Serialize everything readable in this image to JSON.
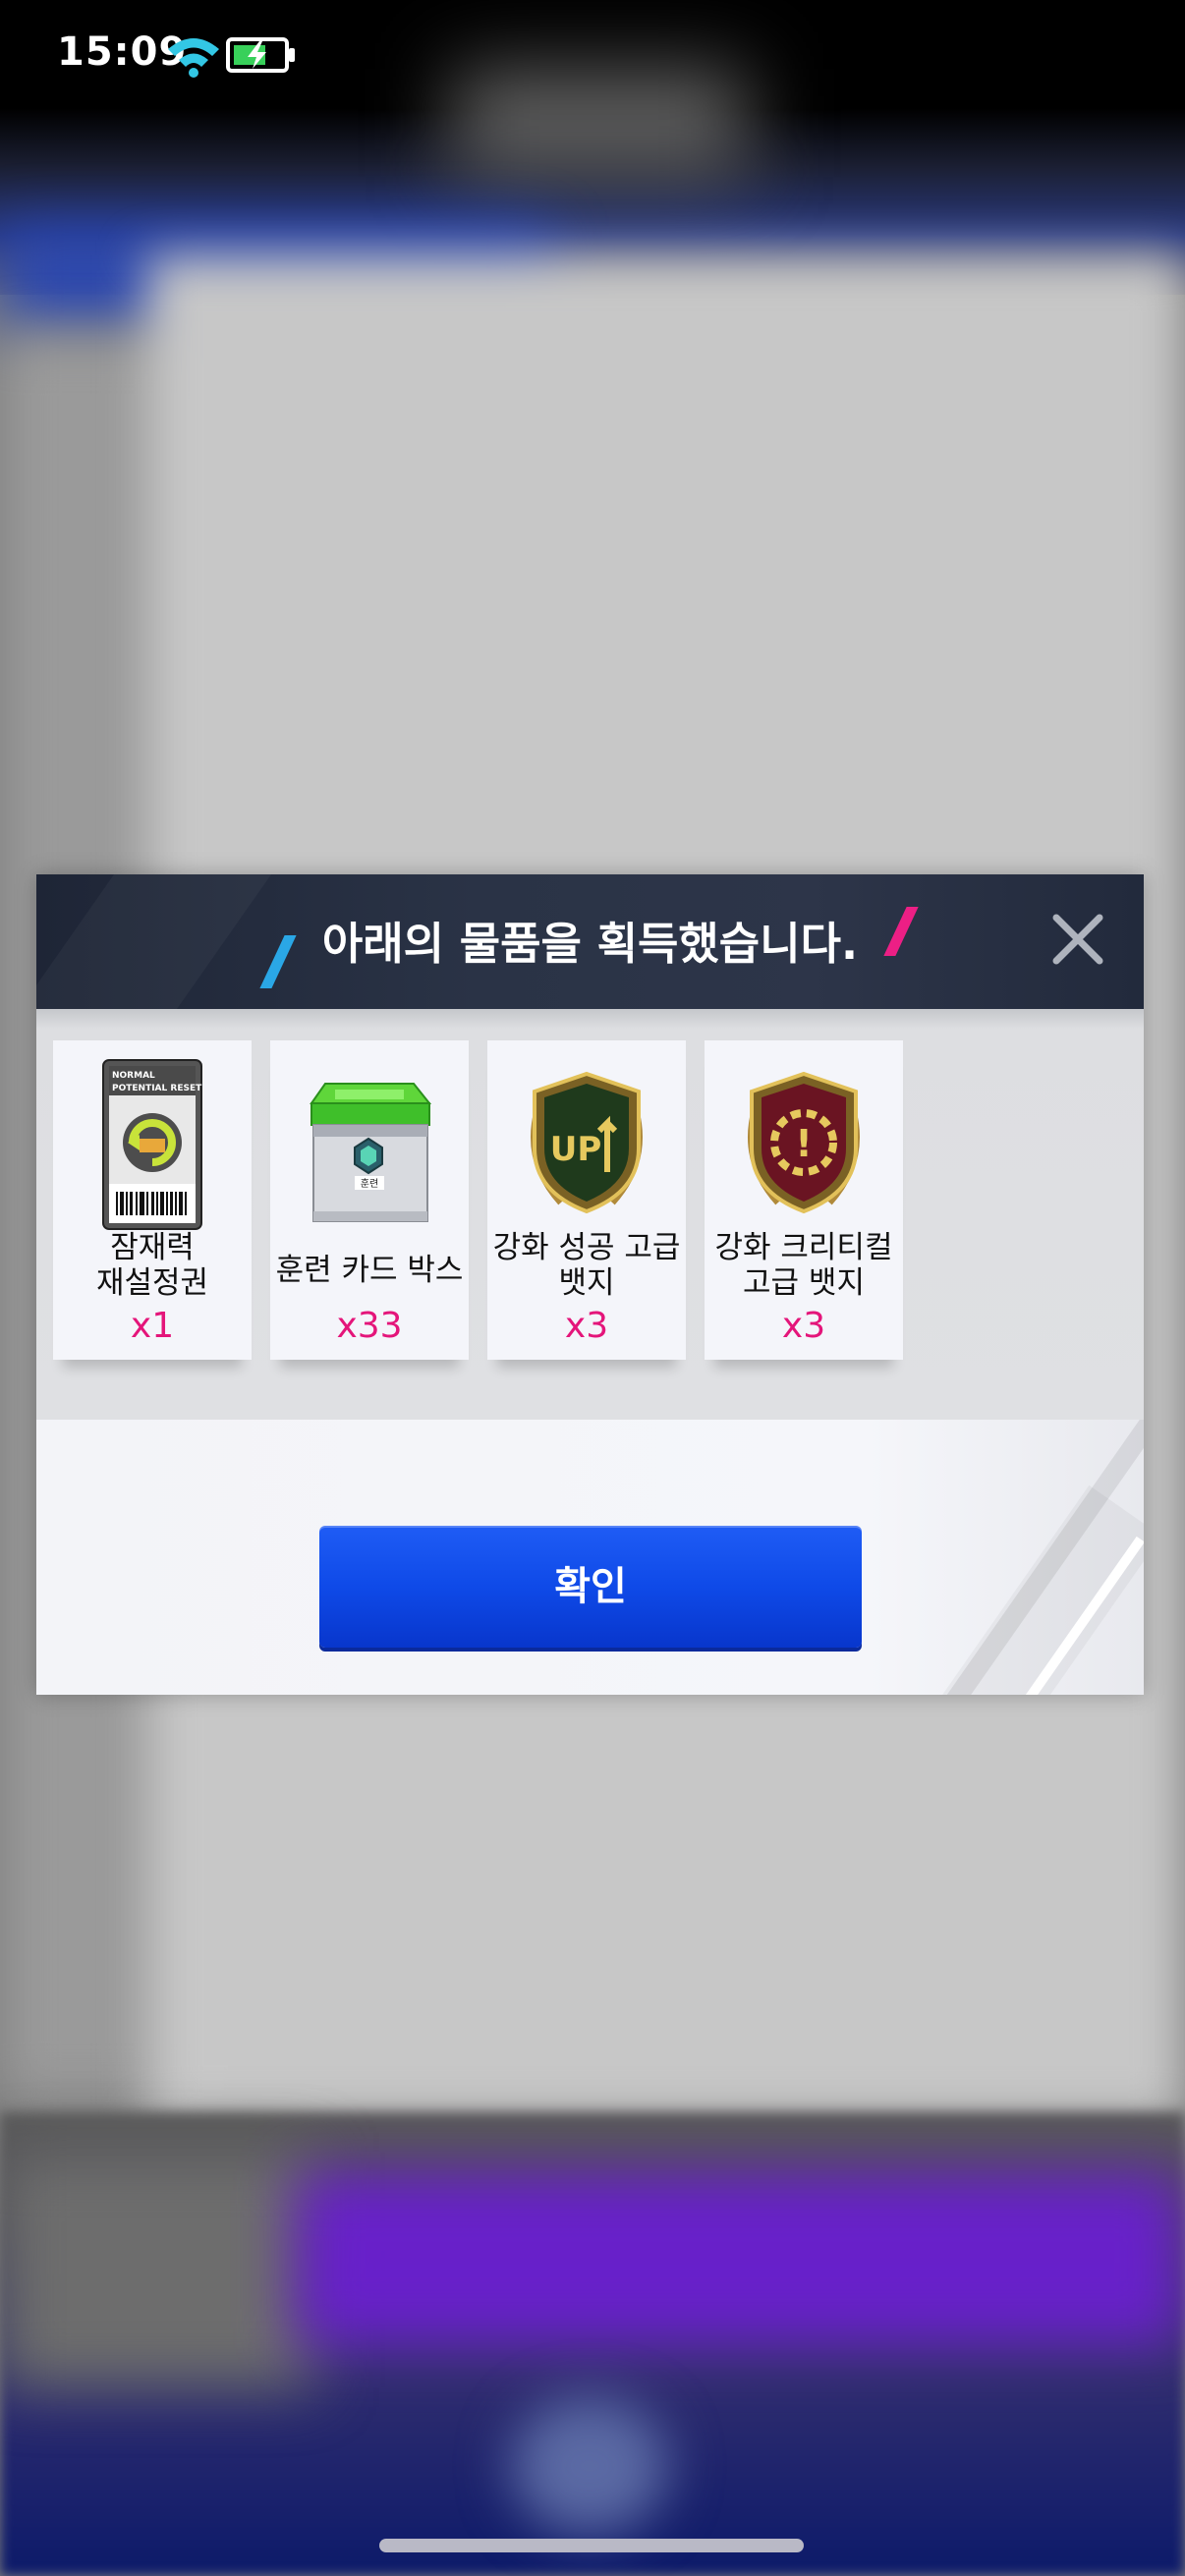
{
  "status_bar": {
    "time": "15:09",
    "wifi_icon": "wifi-icon",
    "battery_icon": "battery-charging-icon"
  },
  "dialog": {
    "title": "아래의 물품을 획득했습니다.",
    "close_icon": "close-icon",
    "items": [
      {
        "name_line1": "잠재력",
        "name_line2": "재설정권",
        "qty": "x1",
        "icon": "potential-reset-ticket-icon",
        "ticket_line1": "NORMAL",
        "ticket_line2": "POTENTIAL RESET"
      },
      {
        "name_line1": "훈련 카드 박스",
        "name_line2": "",
        "qty": "x33",
        "icon": "training-card-box-icon",
        "box_label": "훈련"
      },
      {
        "name_line1": "강화 성공 고급",
        "name_line2": "뱃지",
        "qty": "x3",
        "icon": "upgrade-success-badge-icon",
        "badge_text": "UP"
      },
      {
        "name_line1": "강화 크리티컬",
        "name_line2": "고급 뱃지",
        "qty": "x3",
        "icon": "upgrade-critical-badge-icon",
        "badge_text": "!"
      }
    ],
    "confirm_label": "확인"
  },
  "colors": {
    "qty": "#e4157a",
    "button": "#0f4ae8",
    "header": "#2a3346",
    "accent_blue": "#2aa7e6",
    "accent_pink": "#ec1f85"
  }
}
